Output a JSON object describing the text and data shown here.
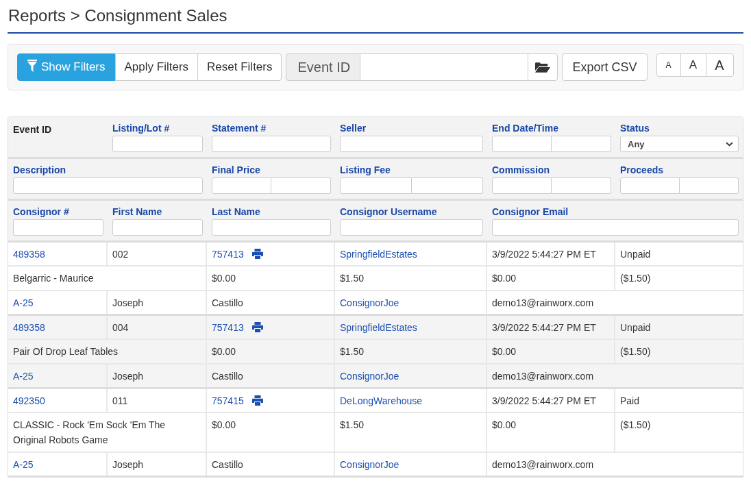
{
  "page": {
    "title": "Reports > Consignment Sales"
  },
  "toolbar": {
    "filter_buttons": [
      {
        "label": "Show Filters",
        "kind": "primary"
      },
      {
        "label": "Apply Filters",
        "kind": "default"
      },
      {
        "label": "Reset Filters",
        "kind": "default"
      }
    ],
    "event_id": {
      "label": "Event ID"
    },
    "export_button": {
      "label": "Export CSV"
    },
    "font_size_buttons": [
      {
        "label": "A",
        "kind": "small"
      },
      {
        "label": "A",
        "kind": "medium"
      },
      {
        "label": "A",
        "kind": "large"
      }
    ]
  },
  "filters": {
    "rows": [
      [
        {
          "label": "Event ID",
          "kind": "label"
        },
        {
          "label": "Listing/Lot #",
          "kind": "text"
        },
        {
          "label": "Statement #",
          "kind": "text"
        },
        {
          "label": "Seller",
          "kind": "text"
        },
        {
          "label": "End Date/Time",
          "kind": "range"
        },
        {
          "label": "Status",
          "kind": "select",
          "value": "Any"
        }
      ],
      [
        {
          "label": "Description",
          "kind": "text",
          "colspan": 2
        },
        {
          "label": "Final Price",
          "kind": "range"
        },
        {
          "label": "Listing Fee",
          "kind": "range"
        },
        {
          "label": "Commission",
          "kind": "range"
        },
        {
          "label": "Proceeds",
          "kind": "range"
        }
      ],
      [
        {
          "label": "Consignor #",
          "kind": "text"
        },
        {
          "label": "First Name",
          "kind": "text"
        },
        {
          "label": "Last Name",
          "kind": "text"
        },
        {
          "label": "Consignor Username",
          "kind": "text"
        },
        {
          "label": "Consignor Email",
          "kind": "text",
          "colspan": 2
        }
      ]
    ]
  },
  "records": [
    {
      "event_id": "489358",
      "lot": "002",
      "statement": "757413",
      "seller": "SpringfieldEstates",
      "end_date": "3/9/2022 5:44:27 PM ET",
      "status": "Unpaid",
      "description": "Belgarric - Maurice",
      "final_price": "$0.00",
      "listing_fee": "$1.50",
      "commission": "$0.00",
      "proceeds": "($1.50)",
      "consignor_no": "A-25",
      "first_name": "Joseph",
      "last_name": "Castillo",
      "username": "ConsignorJoe",
      "email": "demo13@rainworx.com"
    },
    {
      "event_id": "489358",
      "lot": "004",
      "statement": "757413",
      "seller": "SpringfieldEstates",
      "end_date": "3/9/2022 5:44:27 PM ET",
      "status": "Unpaid",
      "description": "Pair Of Drop Leaf Tables",
      "final_price": "$0.00",
      "listing_fee": "$1.50",
      "commission": "$0.00",
      "proceeds": "($1.50)",
      "consignor_no": "A-25",
      "first_name": "Joseph",
      "last_name": "Castillo",
      "username": "ConsignorJoe",
      "email": "demo13@rainworx.com"
    },
    {
      "event_id": "492350",
      "lot": "011",
      "statement": "757415",
      "seller": "DeLongWarehouse",
      "end_date": "3/9/2022 5:44:27 PM ET",
      "status": "Paid",
      "description": "CLASSIC - Rock 'Em Sock 'Em The Original Robots Game",
      "final_price": "$0.00",
      "listing_fee": "$1.50",
      "commission": "$0.00",
      "proceeds": "($1.50)",
      "consignor_no": "A-25",
      "first_name": "Joseph",
      "last_name": "Castillo",
      "username": "ConsignorJoe",
      "email": "demo13@rainworx.com"
    }
  ]
}
